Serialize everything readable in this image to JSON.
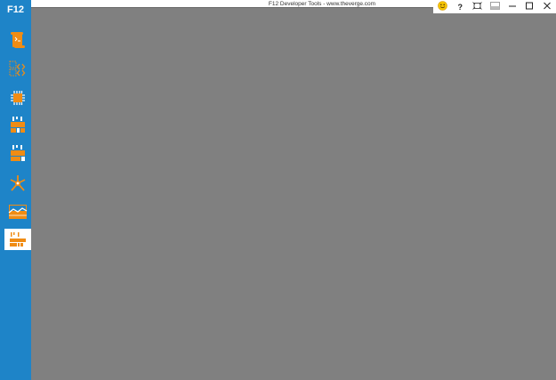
{
  "app": {
    "logo_label": "F12",
    "window_title": "F12 Developer Tools - www.theverge.com"
  },
  "sidebar": {
    "tools": [
      {
        "icon": "debugger-scroll-icon"
      },
      {
        "icon": "dom-explorer-icon"
      },
      {
        "icon": "memory-chip-icon"
      },
      {
        "icon": "network-icon"
      },
      {
        "icon": "performance-icon"
      },
      {
        "icon": "ui-responsiveness-icon"
      },
      {
        "icon": "profiler-chart-icon"
      },
      {
        "icon": "emulation-icon",
        "active": true
      }
    ]
  },
  "window_controls": {
    "feedback_icon": "smiley-icon",
    "help_label": "?",
    "buttons": [
      "unpin-icon",
      "dock-icon",
      "minimize-icon",
      "maximize-icon",
      "close-icon"
    ]
  },
  "colors": {
    "sidebar": "#1e84c8",
    "accent_icon": "#f08c14",
    "content_bg": "#808080"
  }
}
